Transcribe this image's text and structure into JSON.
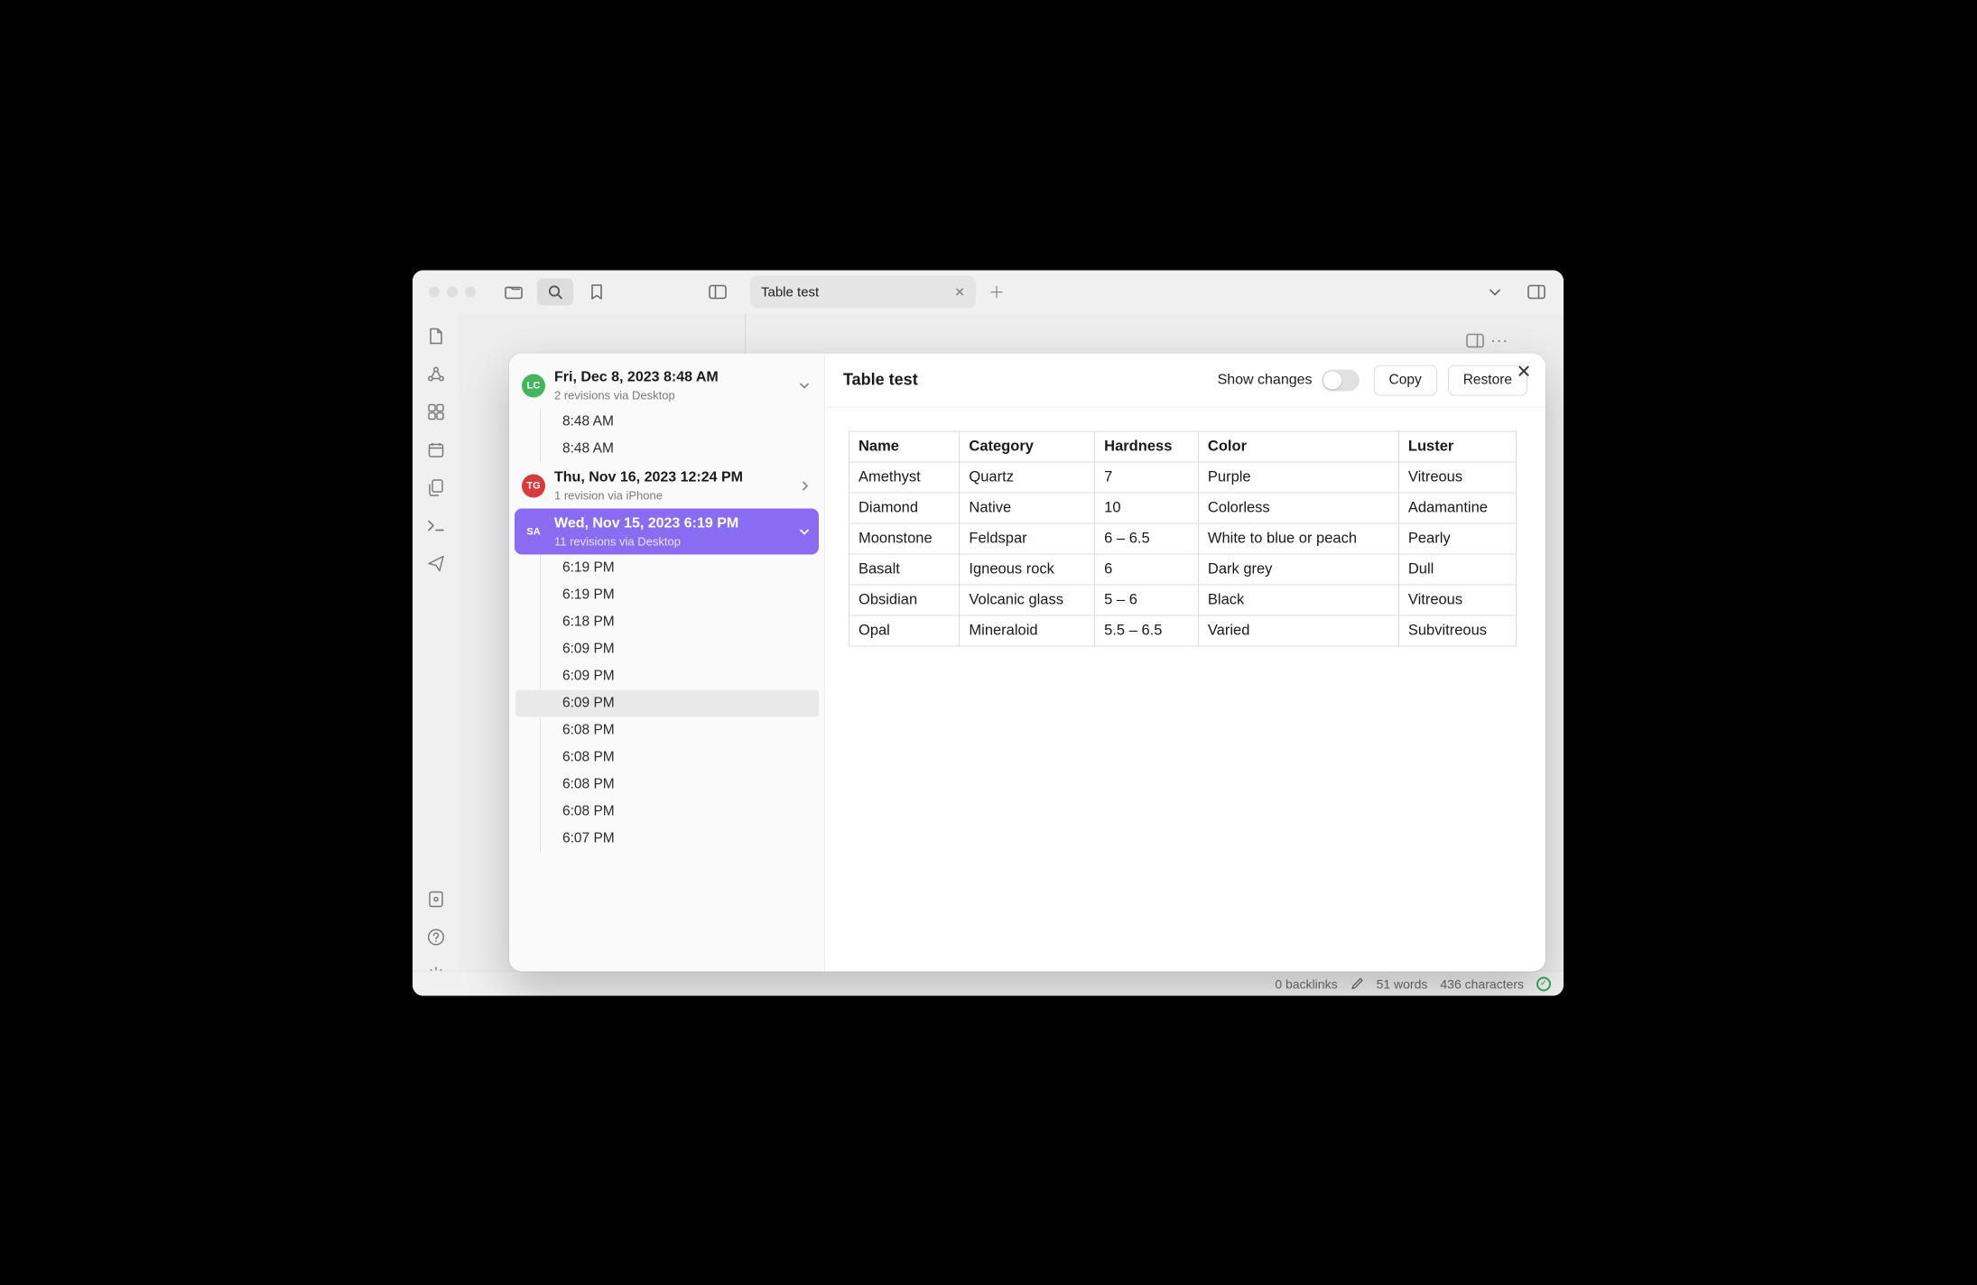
{
  "tab": {
    "title": "Table test"
  },
  "status": {
    "backlinks": "0 backlinks",
    "words": "51 words",
    "chars": "436 characters"
  },
  "history": {
    "blocks": [
      {
        "avatar": "LC",
        "avatar_color": "#43b65d",
        "date": "Fri, Dec 8, 2023 8:48 AM",
        "sub": "2 revisions via Desktop",
        "selected": false,
        "expanded": true,
        "revisions": [
          "8:48 AM",
          "8:48 AM"
        ]
      },
      {
        "avatar": "TG",
        "avatar_color": "#d83b3b",
        "date": "Thu, Nov 16, 2023 12:24 PM",
        "sub": "1 revision via iPhone",
        "selected": false,
        "expanded": false,
        "revisions": []
      },
      {
        "avatar": "SA",
        "avatar_color": "#8a6cf2",
        "date": "Wed, Nov 15, 2023 6:19 PM",
        "sub": "11 revisions via Desktop",
        "selected": true,
        "expanded": true,
        "revisions": [
          "6:19 PM",
          "6:19 PM",
          "6:18 PM",
          "6:09 PM",
          "6:09 PM",
          "6:09 PM",
          "6:08 PM",
          "6:08 PM",
          "6:08 PM",
          "6:08 PM",
          "6:07 PM"
        ],
        "selected_index": 5
      }
    ]
  },
  "preview": {
    "title": "Table test",
    "show_changes_label": "Show changes",
    "copy": "Copy",
    "restore": "Restore",
    "table": {
      "headers": [
        "Name",
        "Category",
        "Hardness",
        "Color",
        "Luster"
      ],
      "rows": [
        [
          "Amethyst",
          "Quartz",
          "7",
          "Purple",
          "Vitreous"
        ],
        [
          "Diamond",
          "Native",
          "10",
          "Colorless",
          "Adamantine"
        ],
        [
          "Moonstone",
          "Feldspar",
          "6 – 6.5",
          "White to blue or peach",
          "Pearly"
        ],
        [
          "Basalt",
          "Igneous rock",
          "6",
          "Dark grey",
          "Dull"
        ],
        [
          "Obsidian",
          "Volcanic glass",
          "5 – 6",
          "Black",
          "Vitreous"
        ],
        [
          "Opal",
          "Mineraloid",
          "5.5 – 6.5",
          "Varied",
          "Subvitreous"
        ]
      ]
    }
  }
}
